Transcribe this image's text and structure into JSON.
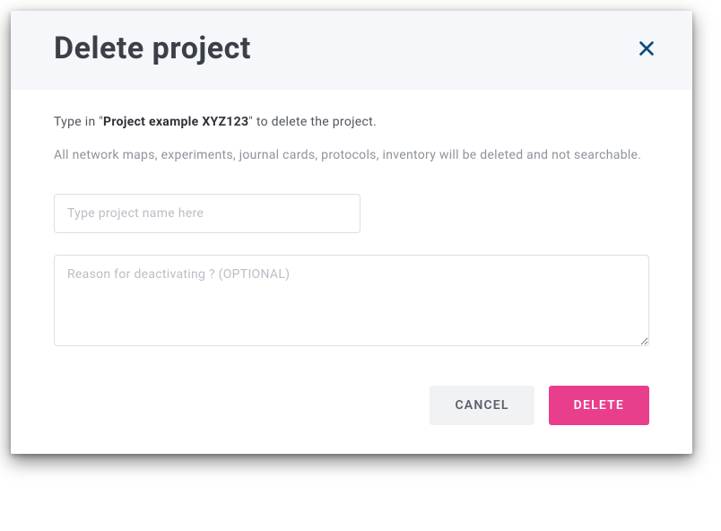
{
  "header": {
    "title": "Delete project"
  },
  "body": {
    "instruction_prefix": "Type in \"",
    "project_name": "Project example XYZ123",
    "instruction_suffix": "\" to delete the project.",
    "warning": "All network maps, experiments, journal cards, protocols, inventory will be deleted and not searchable.",
    "input_placeholder": "Type project name here",
    "textarea_placeholder": "Reason for deactivating ? (OPTIONAL)"
  },
  "footer": {
    "cancel_label": "CANCEL",
    "delete_label": "DELETE"
  },
  "colors": {
    "close_icon": "#0a4d7a",
    "delete_button": "#e83e8c"
  }
}
